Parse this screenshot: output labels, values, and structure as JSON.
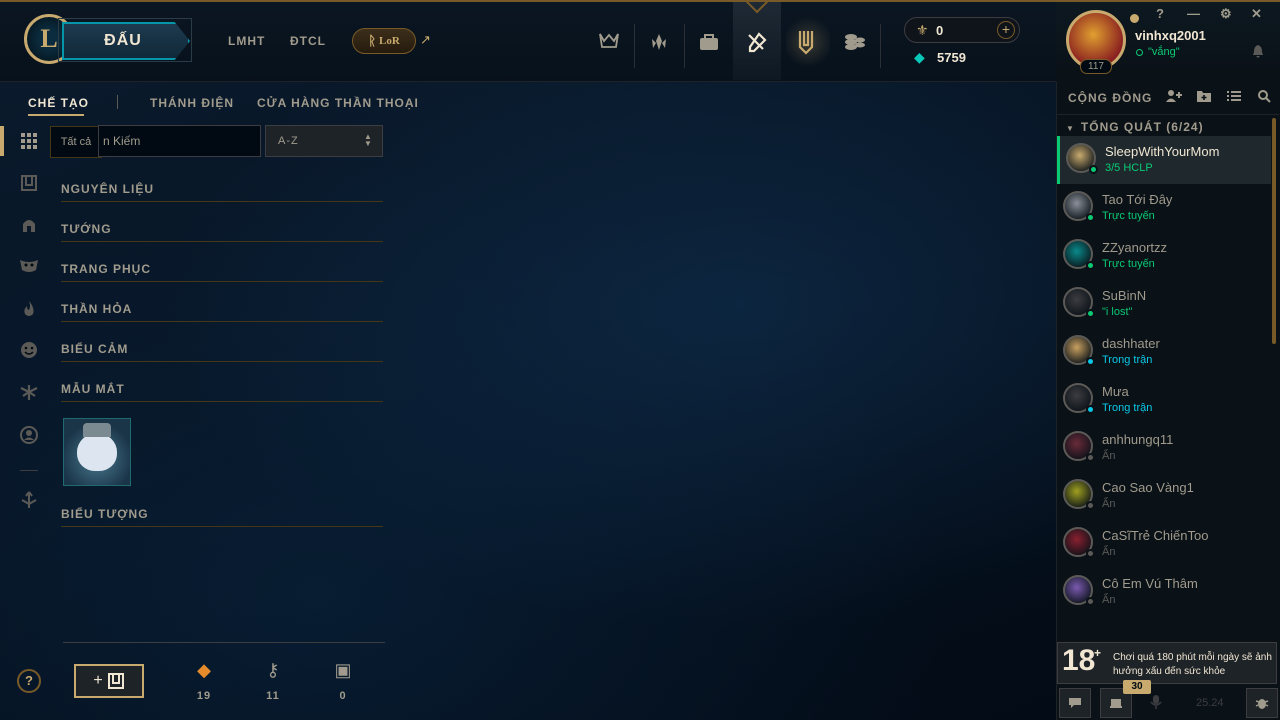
{
  "topnav": {
    "logo": "L",
    "play_label": "ĐẤU",
    "links": [
      "LMHT",
      "ĐTCL"
    ],
    "lor_label": "LoR",
    "lor_ext": "↗",
    "rp": "0",
    "blue_essence": "5759"
  },
  "subtabs": {
    "craft": "CHẾ TẠO",
    "hall": "THÁNH ĐIỆN",
    "mythic_shop": "CỬA HÀNG THẦN THOẠI"
  },
  "filter": {
    "tooltip": "Tất cả",
    "search_placeholder": "n Kiếm",
    "sort_value": "A-Z"
  },
  "sections": [
    "NGUYÊN LIỆU",
    "TƯỚNG",
    "TRANG PHỤC",
    "THẦN HỎA",
    "BIỂU CẢM",
    "MẪU MẮT",
    "BIỂU TƯỢNG"
  ],
  "bottom": {
    "help": "?",
    "craft_btn": "+",
    "resources": [
      {
        "icon": "orange-essence-icon",
        "glyph": "◆",
        "value": "19",
        "color": "#e58b2c"
      },
      {
        "icon": "key-icon",
        "glyph": "⚷",
        "value": "11",
        "color": "#a09b8c"
      },
      {
        "icon": "chest-icon",
        "glyph": "▣",
        "value": "0",
        "color": "#a09b8c"
      }
    ]
  },
  "profile": {
    "level": "117",
    "username": "vinhxq2001",
    "status": "\"vắng\""
  },
  "social": {
    "title": "CỘNG ĐỒNG",
    "group": "TỔNG QUÁT (6/24)",
    "friends": [
      {
        "name": "SleepWithYourMom",
        "status": "3/5 HCLP",
        "status_color": "#0acb74",
        "dot": "#0acb74",
        "avatar": "#c8aa6e"
      },
      {
        "name": "Tao Tới Đây",
        "status": "Trực tuyến",
        "status_color": "#0acb74",
        "dot": "#0acb74",
        "avatar": "#8a8f99"
      },
      {
        "name": "ZZyanortzz",
        "status": "Trực tuyến",
        "status_color": "#0acb74",
        "dot": "#0acb74",
        "avatar": "#0a8a8a"
      },
      {
        "name": "SuBinN",
        "status": "\"i lost\"",
        "status_color": "#0acb74",
        "dot": "#0acb74",
        "avatar": "#3c3c41"
      },
      {
        "name": "dashhater",
        "status": "Trong trận",
        "status_color": "#0ac8e8",
        "dot": "#0ac8e8",
        "avatar": "#c8a060"
      },
      {
        "name": "Mưa",
        "status": "Trong trận",
        "status_color": "#0ac8e8",
        "dot": "#0ac8e8",
        "avatar": "#3c3c41"
      },
      {
        "name": "anhhungq11",
        "status": "Ẩn",
        "status_color": "#5b5a56",
        "dot": "#5b5a56",
        "avatar": "#6a2a3a"
      },
      {
        "name": "Cao Sao Vàng1",
        "status": "Ẩn",
        "status_color": "#5b5a56",
        "dot": "#5b5a56",
        "avatar": "#a0a020"
      },
      {
        "name": "CaSĩTrẻ ChiếnToo",
        "status": "Ẩn",
        "status_color": "#5b5a56",
        "dot": "#5b5a56",
        "avatar": "#8a2030"
      },
      {
        "name": "Cô Em Vú Thâm",
        "status": "Ẩn",
        "status_color": "#5b5a56",
        "dot": "#5b5a56",
        "avatar": "#7a5ab0"
      }
    ]
  },
  "warning": {
    "age": "18",
    "plus": "+",
    "text": "Chơi quá 180 phút mỗi ngày sẽ ảnh hưởng xấu đến sức khỏe"
  },
  "footer": {
    "badge": "30",
    "version": "25.24"
  }
}
